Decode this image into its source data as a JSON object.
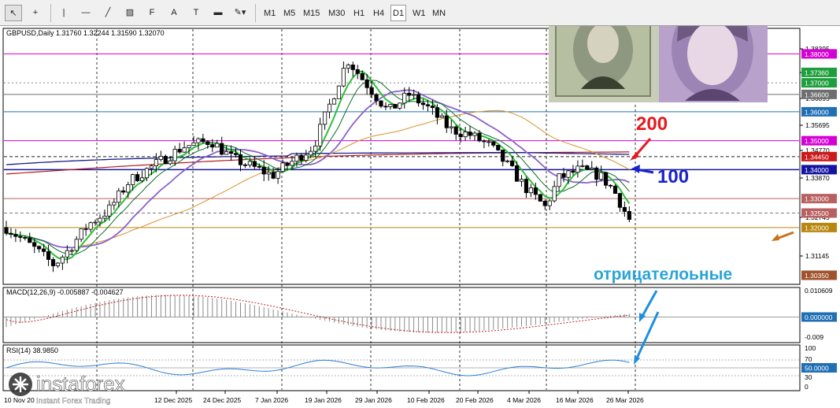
{
  "toolbar": {
    "tools": [
      {
        "name": "cursor-icon",
        "glyph": "↖"
      },
      {
        "name": "crosshair-icon",
        "glyph": "+"
      },
      {
        "name": "vertical-line-icon",
        "glyph": "|"
      },
      {
        "name": "horizontal-line-icon",
        "glyph": "—"
      },
      {
        "name": "trendline-icon",
        "glyph": "╱"
      },
      {
        "name": "channel-icon",
        "glyph": "▨"
      },
      {
        "name": "fibonacci-icon",
        "glyph": "F"
      },
      {
        "name": "text-icon",
        "glyph": "A"
      },
      {
        "name": "label-icon",
        "glyph": "T"
      },
      {
        "name": "rectangle-icon",
        "glyph": "▬"
      },
      {
        "name": "shapes-menu-icon",
        "glyph": "✎▾"
      }
    ],
    "timeframes": [
      "M1",
      "M5",
      "M15",
      "M30",
      "H1",
      "H4",
      "D1",
      "W1",
      "MN"
    ],
    "active_timeframe": "D1"
  },
  "chart": {
    "header": "GBPUSD,Daily  1.31760 1.32244 1.31590 1.32070",
    "macd_header": "MACD(12,26,9) -0.005887 -0.004627",
    "rsi_header": "RSI(14) 38.9850",
    "price_ticks": [
      "1.38395",
      "1.37245",
      "1.36095",
      "1.35695",
      "1.34770",
      "1.33870",
      "1.32745",
      "1.31145"
    ],
    "price_labels": [
      {
        "text": "1.38000",
        "color": "#d400d4"
      },
      {
        "text": "1.37360",
        "color": "#1e9e3c"
      },
      {
        "text": "1.37000",
        "color": "#1e9e3c"
      },
      {
        "text": "1.36600",
        "color": "#6e6e6e"
      },
      {
        "text": "1.36000",
        "color": "#1f6fb4"
      },
      {
        "text": "1.35000",
        "color": "#d400d4"
      },
      {
        "text": "1.34450",
        "color": "#cc1a1a"
      },
      {
        "text": "1.34000",
        "color": "#1414a0"
      },
      {
        "text": "1.33000",
        "color": "#b86060"
      },
      {
        "text": "1.32500",
        "color": "#b86060"
      },
      {
        "text": "1.32000",
        "color": "#b8860b"
      },
      {
        "text": "1.30350",
        "color": "#a0522d"
      }
    ],
    "macd_ticks": [
      "0.010609",
      "0.000000",
      "-0.009"
    ],
    "rsi_ticks": [
      "100",
      "70",
      "50.0000",
      "30",
      "0"
    ],
    "dates": [
      "12 Dec 2025",
      "24 Dec 2025",
      "7 Jan 2026",
      "19 Jan 2026",
      "29 Jan 2026",
      "10 Feb 2026",
      "20 Feb 2026",
      "4 Mar 2026",
      "16 Mar 2026",
      "26 Mar 2026"
    ],
    "date_left_stub": "10 Nov 20"
  },
  "annotations": {
    "ma200": "200",
    "ma100": "100",
    "negative": "отрицателоьные"
  },
  "branding": {
    "logo": "instaforex",
    "tagline": "Instant Forex Trading"
  }
}
